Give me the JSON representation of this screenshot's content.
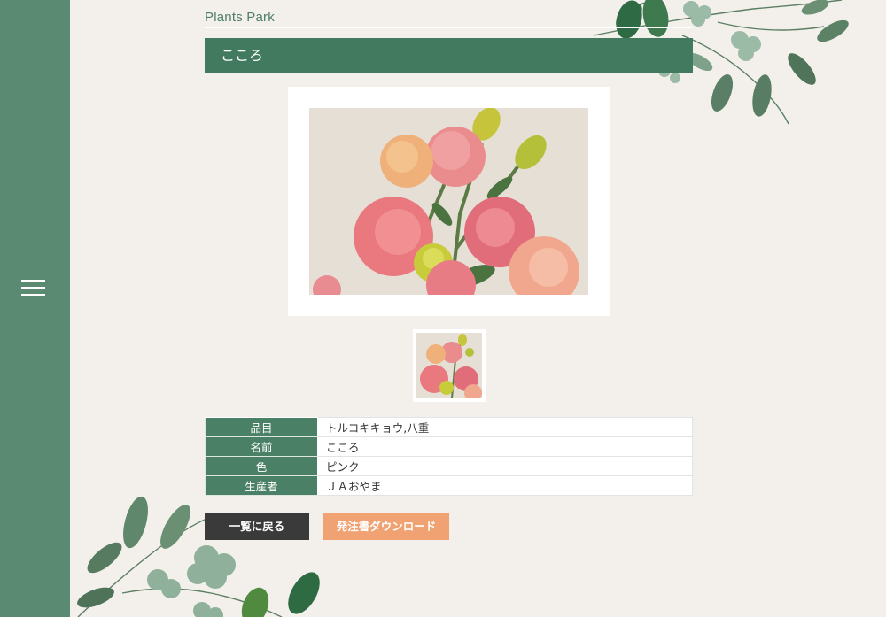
{
  "site": {
    "title": "Plants Park"
  },
  "header": {
    "title": "こころ"
  },
  "nav": {
    "menu_icon": "hamburger-menu-icon"
  },
  "product": {
    "main_image_alt": "pink lisianthus flowers",
    "thumbnail_alt": "pink lisianthus thumbnail",
    "details": [
      {
        "label": "品目",
        "value": "トルコキキョウ,八重"
      },
      {
        "label": "名前",
        "value": "こころ"
      },
      {
        "label": "色",
        "value": "ピンク"
      },
      {
        "label": "生産者",
        "value": "ＪＡおやま"
      }
    ]
  },
  "actions": {
    "back_label": "一覧に戻る",
    "download_label": "発注書ダウンロード"
  },
  "colors": {
    "sidebar": "#5a8a72",
    "header_bar": "#427a60",
    "table_header": "#4a8066",
    "back_button": "#3a3a3a",
    "download_button": "#f0a272",
    "background": "#f3f0ec"
  }
}
